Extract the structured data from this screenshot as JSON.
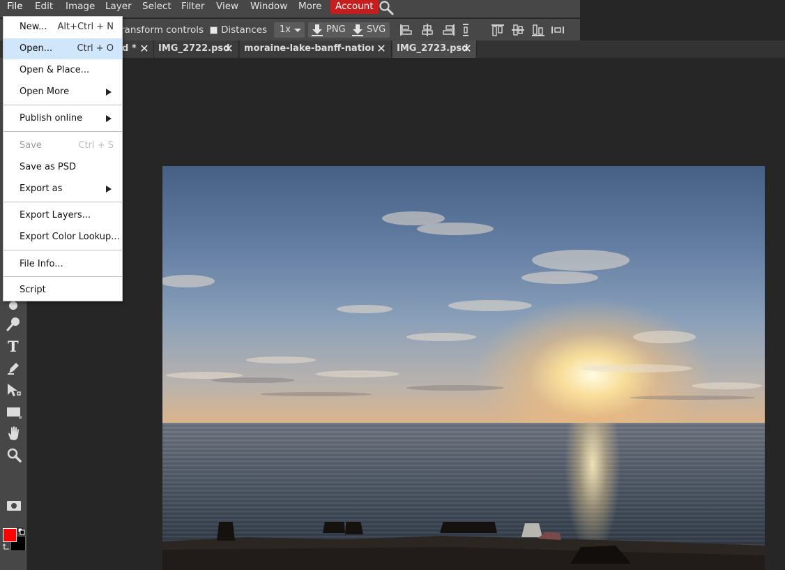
{
  "menubar": {
    "items": [
      "File",
      "Edit",
      "Image",
      "Layer",
      "Select",
      "Filter",
      "View",
      "Window",
      "More"
    ],
    "account_label": "Account",
    "accent_color": "#c41e1e"
  },
  "options": {
    "transform_label": "ransform controls",
    "distances_label": "Distances",
    "distances_checked": false,
    "scale_value": "1x",
    "png_label": "PNG",
    "svg_label": "SVG"
  },
  "tabs": [
    {
      "title": "d *",
      "active": false
    },
    {
      "title": "IMG_2722.psd",
      "active": false
    },
    {
      "title": "moraine-lake-banff-national",
      "active": false
    },
    {
      "title": "IMG_2723.psd",
      "active": true
    }
  ],
  "file_menu": {
    "items": [
      {
        "label": "New...",
        "shortcut": "Alt+Ctrl + N"
      },
      {
        "label": "Open...",
        "shortcut": "Ctrl + O",
        "highlighted": true
      },
      {
        "label": "Open & Place..."
      },
      {
        "label": "Open More",
        "submenu": true
      },
      {
        "label": "Publish online",
        "submenu": true
      },
      {
        "label": "Save",
        "shortcut": "Ctrl + S",
        "disabled": true
      },
      {
        "label": "Save as PSD"
      },
      {
        "label": "Export as",
        "submenu": true
      },
      {
        "label": "Export Layers..."
      },
      {
        "label": "Export Color Lookup..."
      },
      {
        "label": "File Info..."
      },
      {
        "label": "Script"
      }
    ]
  },
  "toolbar": {
    "foreground_color": "#ff0000",
    "background_color": "#000000",
    "tool_icons": [
      "dodge-tool-icon",
      "smudge-tool-icon",
      "type-tool-icon",
      "pen-tool-icon",
      "path-select-tool-icon",
      "rectangle-tool-icon",
      "hand-tool-icon",
      "zoom-tool-icon"
    ]
  }
}
